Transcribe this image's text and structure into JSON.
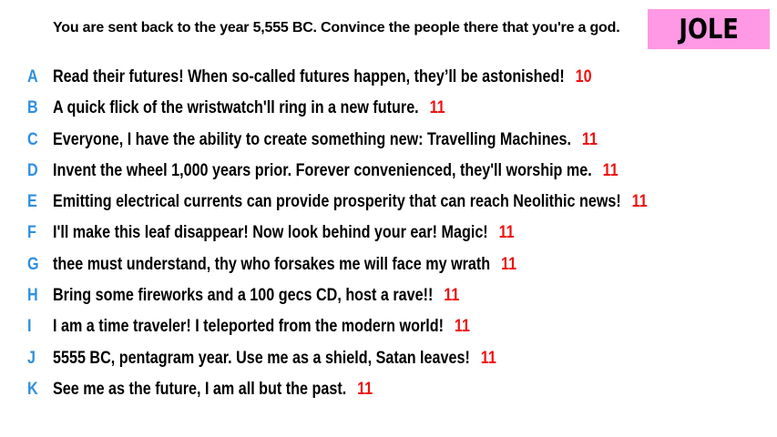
{
  "prompt": "You are sent back to the year 5,555 BC. Convince the people there that you're a god.",
  "badge": {
    "label": "JOLE",
    "color": "#ff99e5"
  },
  "colors": {
    "letter": "#2f8fe0",
    "score": "#ee1111"
  },
  "answers": [
    {
      "letter": "A",
      "text": "Read their futures! When so-called futures happen, they’ll be astonished!",
      "score": "10"
    },
    {
      "letter": "B",
      "text": "A quick flick of the wristwatch'll ring in a new future.",
      "score": "11"
    },
    {
      "letter": "C",
      "text": "Everyone, I have the ability to create something new: Travelling Machines.",
      "score": "11"
    },
    {
      "letter": "D",
      "text": "Invent the wheel 1,000 years prior. Forever convenienced, they'll worship me.",
      "score": "11"
    },
    {
      "letter": "E",
      "text": "Emitting electrical currents can provide prosperity that can reach Neolithic news!",
      "score": "11"
    },
    {
      "letter": "F",
      "text": "I'll make this leaf disappear! Now look behind your ear! Magic!",
      "score": "11"
    },
    {
      "letter": "G",
      "text": "thee must understand, thy who forsakes me will face my wrath",
      "score": "11"
    },
    {
      "letter": "H",
      "text": "Bring some fireworks and a 100 gecs CD, host a rave!!",
      "score": "11"
    },
    {
      "letter": "I",
      "text": "I am a time traveler! I teleported from the modern world!",
      "score": "11"
    },
    {
      "letter": "J",
      "text": "5555 BC, pentagram year. Use me as a shield, Satan leaves!",
      "score": "11"
    },
    {
      "letter": "K",
      "text": "See me as the future, I am all but the past.",
      "score": "11"
    }
  ]
}
